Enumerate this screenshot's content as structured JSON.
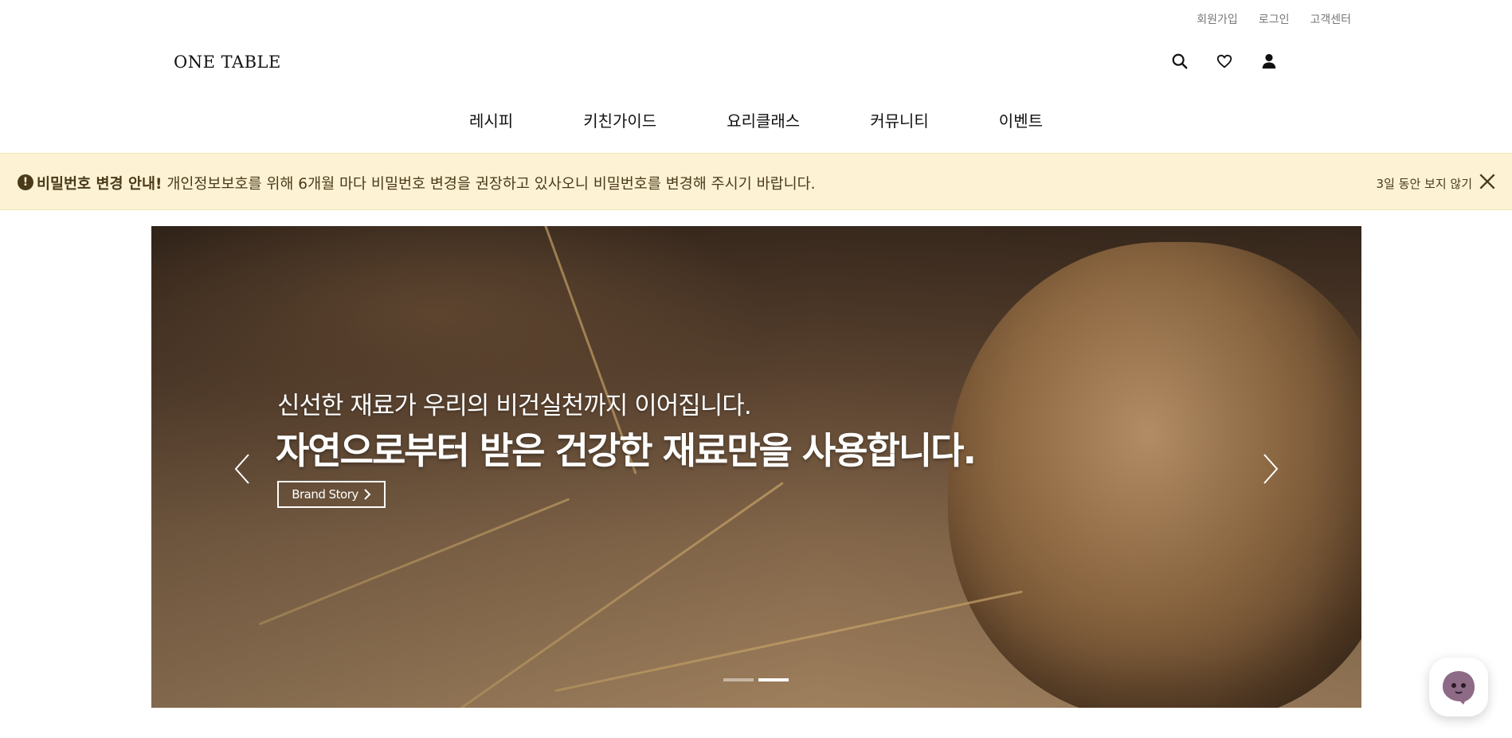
{
  "util_links": [
    "회원가입",
    "로그인",
    "고객센터"
  ],
  "logo": "ONE TABLE",
  "header_icons": [
    "search-icon",
    "heart-icon",
    "user-icon"
  ],
  "gnb": [
    "레시피",
    "키친가이드",
    "요리클래스",
    "커뮤니티",
    "이벤트"
  ],
  "notice": {
    "title": "비밀번호 변경 안내!",
    "message": " 개인정보보호를 위해 6개월 마다 비밀번호 변경을 권장하고 있사오니 비밀번호를 변경해 주시기 바랍니다.",
    "dismiss_label": "3일 동안 보지 않기",
    "colors": {
      "background": "#fdf3d4",
      "text": "#4a3a1a"
    }
  },
  "hero": {
    "subtitle": "신선한 재료가 우리의 비건실천까지 이어집니다.",
    "headline": "자연으로부터 받은 건강한 재료만을 사용합니다.",
    "cta_label": "Brand Story",
    "slide_count": 2,
    "active_slide": 2
  }
}
